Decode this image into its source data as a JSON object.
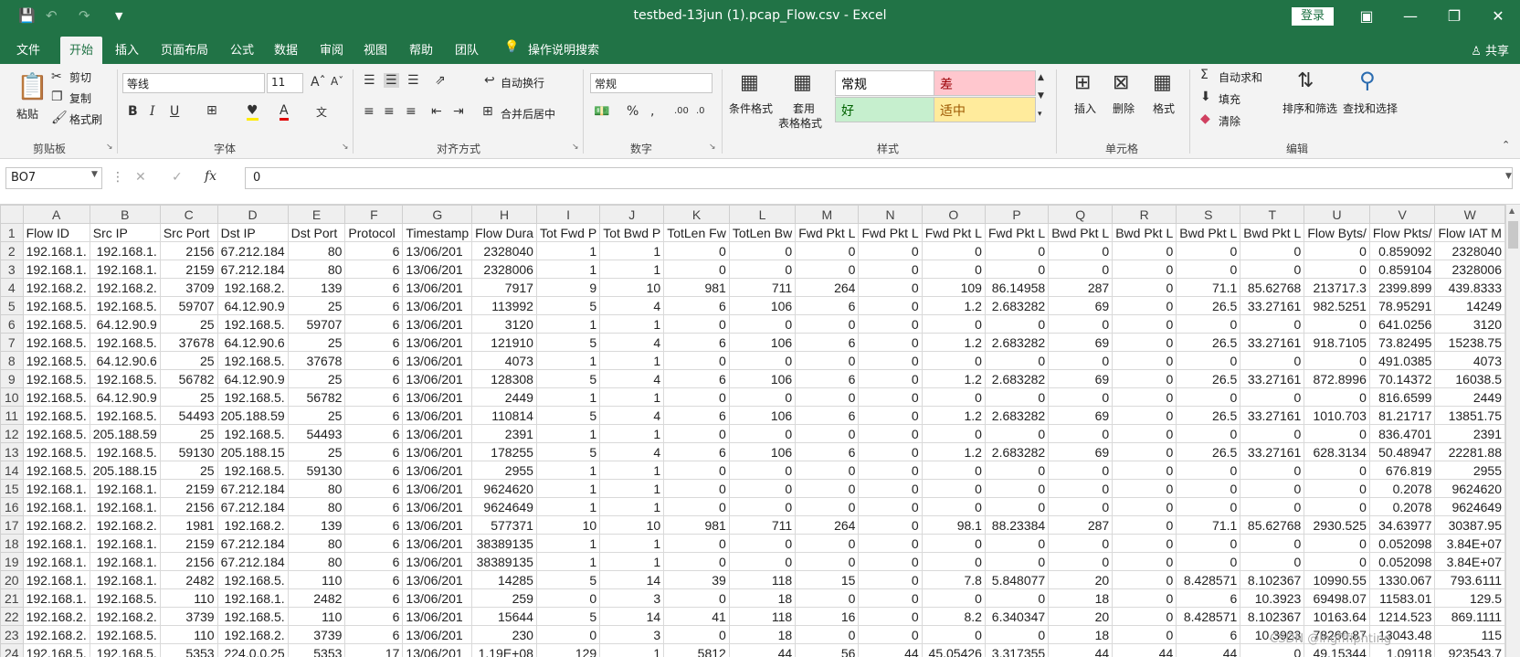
{
  "window": {
    "title": "testbed-13jun (1).pcap_Flow.csv  -  Excel",
    "login_label": "登录"
  },
  "tabs": [
    "文件",
    "开始",
    "插入",
    "页面布局",
    "公式",
    "数据",
    "审阅",
    "视图",
    "帮助",
    "团队"
  ],
  "search_label": "操作说明搜索",
  "share_label": "共享",
  "ribbon": {
    "clipboard": {
      "paste": "粘贴",
      "cut": "剪切",
      "copy": "复制",
      "painter": "格式刷",
      "group": "剪贴板"
    },
    "font": {
      "name": "等线",
      "size": "11",
      "group": "字体"
    },
    "align": {
      "wrap": "自动换行",
      "merge": "合并后居中",
      "group": "对齐方式"
    },
    "number": {
      "format": "常规",
      "group": "数字"
    },
    "styles": {
      "cond": "条件格式",
      "table1": "套用",
      "table2": "表格格式",
      "normal": "常规",
      "bad": "差",
      "good": "好",
      "neutral": "适中",
      "group": "样式"
    },
    "cells": {
      "insert": "插入",
      "delete": "删除",
      "format": "格式",
      "group": "单元格"
    },
    "editing": {
      "autosum": "自动求和",
      "fill": "填充",
      "clear": "清除",
      "sort": "排序和筛选",
      "find": "查找和选择",
      "group": "编辑"
    }
  },
  "formula_bar": {
    "name_box": "BO7",
    "value": "0"
  },
  "columns": [
    "A",
    "B",
    "C",
    "D",
    "E",
    "F",
    "G",
    "H",
    "I",
    "J",
    "K",
    "L",
    "M",
    "N",
    "O",
    "P",
    "Q",
    "R",
    "S",
    "T",
    "U",
    "V",
    "W"
  ],
  "rows": [
    [
      "Flow ID",
      "Src IP",
      "Src Port",
      "Dst IP",
      "Dst Port",
      "Protocol",
      "Timestamp",
      "Flow Dura",
      "Tot Fwd P",
      "Tot Bwd P",
      "TotLen Fw",
      "TotLen Bw",
      "Fwd Pkt L",
      "Fwd Pkt L",
      "Fwd Pkt L",
      "Fwd Pkt L",
      "Bwd Pkt L",
      "Bwd Pkt L",
      "Bwd Pkt L",
      "Bwd Pkt L",
      "Flow Byts/",
      "Flow Pkts/",
      "Flow IAT M"
    ],
    [
      "192.168.1.",
      "192.168.1.",
      "2156",
      "67.212.184",
      "80",
      "6",
      "13/06/201",
      "2328040",
      "1",
      "1",
      "0",
      "0",
      "0",
      "0",
      "0",
      "0",
      "0",
      "0",
      "0",
      "0",
      "0",
      "0.859092",
      "2328040"
    ],
    [
      "192.168.1.",
      "192.168.1.",
      "2159",
      "67.212.184",
      "80",
      "6",
      "13/06/201",
      "2328006",
      "1",
      "1",
      "0",
      "0",
      "0",
      "0",
      "0",
      "0",
      "0",
      "0",
      "0",
      "0",
      "0",
      "0.859104",
      "2328006"
    ],
    [
      "192.168.2.",
      "192.168.2.",
      "3709",
      "192.168.2.",
      "139",
      "6",
      "13/06/201",
      "7917",
      "9",
      "10",
      "981",
      "711",
      "264",
      "0",
      "109",
      "86.14958",
      "287",
      "0",
      "71.1",
      "85.62768",
      "213717.3",
      "2399.899",
      "439.8333"
    ],
    [
      "192.168.5.",
      "192.168.5.",
      "59707",
      "64.12.90.9",
      "25",
      "6",
      "13/06/201",
      "113992",
      "5",
      "4",
      "6",
      "106",
      "6",
      "0",
      "1.2",
      "2.683282",
      "69",
      "0",
      "26.5",
      "33.27161",
      "982.5251",
      "78.95291",
      "14249"
    ],
    [
      "192.168.5.",
      "64.12.90.9",
      "25",
      "192.168.5.",
      "59707",
      "6",
      "13/06/201",
      "3120",
      "1",
      "1",
      "0",
      "0",
      "0",
      "0",
      "0",
      "0",
      "0",
      "0",
      "0",
      "0",
      "0",
      "641.0256",
      "3120"
    ],
    [
      "192.168.5.",
      "192.168.5.",
      "37678",
      "64.12.90.6",
      "25",
      "6",
      "13/06/201",
      "121910",
      "5",
      "4",
      "6",
      "106",
      "6",
      "0",
      "1.2",
      "2.683282",
      "69",
      "0",
      "26.5",
      "33.27161",
      "918.7105",
      "73.82495",
      "15238.75"
    ],
    [
      "192.168.5.",
      "64.12.90.6",
      "25",
      "192.168.5.",
      "37678",
      "6",
      "13/06/201",
      "4073",
      "1",
      "1",
      "0",
      "0",
      "0",
      "0",
      "0",
      "0",
      "0",
      "0",
      "0",
      "0",
      "0",
      "491.0385",
      "4073"
    ],
    [
      "192.168.5.",
      "192.168.5.",
      "56782",
      "64.12.90.9",
      "25",
      "6",
      "13/06/201",
      "128308",
      "5",
      "4",
      "6",
      "106",
      "6",
      "0",
      "1.2",
      "2.683282",
      "69",
      "0",
      "26.5",
      "33.27161",
      "872.8996",
      "70.14372",
      "16038.5"
    ],
    [
      "192.168.5.",
      "64.12.90.9",
      "25",
      "192.168.5.",
      "56782",
      "6",
      "13/06/201",
      "2449",
      "1",
      "1",
      "0",
      "0",
      "0",
      "0",
      "0",
      "0",
      "0",
      "0",
      "0",
      "0",
      "0",
      "816.6599",
      "2449"
    ],
    [
      "192.168.5.",
      "192.168.5.",
      "54493",
      "205.188.59",
      "25",
      "6",
      "13/06/201",
      "110814",
      "5",
      "4",
      "6",
      "106",
      "6",
      "0",
      "1.2",
      "2.683282",
      "69",
      "0",
      "26.5",
      "33.27161",
      "1010.703",
      "81.21717",
      "13851.75"
    ],
    [
      "192.168.5.",
      "205.188.59",
      "25",
      "192.168.5.",
      "54493",
      "6",
      "13/06/201",
      "2391",
      "1",
      "1",
      "0",
      "0",
      "0",
      "0",
      "0",
      "0",
      "0",
      "0",
      "0",
      "0",
      "0",
      "836.4701",
      "2391"
    ],
    [
      "192.168.5.",
      "192.168.5.",
      "59130",
      "205.188.15",
      "25",
      "6",
      "13/06/201",
      "178255",
      "5",
      "4",
      "6",
      "106",
      "6",
      "0",
      "1.2",
      "2.683282",
      "69",
      "0",
      "26.5",
      "33.27161",
      "628.3134",
      "50.48947",
      "22281.88"
    ],
    [
      "192.168.5.",
      "205.188.15",
      "25",
      "192.168.5.",
      "59130",
      "6",
      "13/06/201",
      "2955",
      "1",
      "1",
      "0",
      "0",
      "0",
      "0",
      "0",
      "0",
      "0",
      "0",
      "0",
      "0",
      "0",
      "676.819",
      "2955"
    ],
    [
      "192.168.1.",
      "192.168.1.",
      "2159",
      "67.212.184",
      "80",
      "6",
      "13/06/201",
      "9624620",
      "1",
      "1",
      "0",
      "0",
      "0",
      "0",
      "0",
      "0",
      "0",
      "0",
      "0",
      "0",
      "0",
      "0.2078",
      "9624620"
    ],
    [
      "192.168.1.",
      "192.168.1.",
      "2156",
      "67.212.184",
      "80",
      "6",
      "13/06/201",
      "9624649",
      "1",
      "1",
      "0",
      "0",
      "0",
      "0",
      "0",
      "0",
      "0",
      "0",
      "0",
      "0",
      "0",
      "0.2078",
      "9624649"
    ],
    [
      "192.168.2.",
      "192.168.2.",
      "1981",
      "192.168.2.",
      "139",
      "6",
      "13/06/201",
      "577371",
      "10",
      "10",
      "981",
      "711",
      "264",
      "0",
      "98.1",
      "88.23384",
      "287",
      "0",
      "71.1",
      "85.62768",
      "2930.525",
      "34.63977",
      "30387.95"
    ],
    [
      "192.168.1.",
      "192.168.1.",
      "2159",
      "67.212.184",
      "80",
      "6",
      "13/06/201",
      "38389135",
      "1",
      "1",
      "0",
      "0",
      "0",
      "0",
      "0",
      "0",
      "0",
      "0",
      "0",
      "0",
      "0",
      "0.052098",
      "3.84E+07"
    ],
    [
      "192.168.1.",
      "192.168.1.",
      "2156",
      "67.212.184",
      "80",
      "6",
      "13/06/201",
      "38389135",
      "1",
      "1",
      "0",
      "0",
      "0",
      "0",
      "0",
      "0",
      "0",
      "0",
      "0",
      "0",
      "0",
      "0.052098",
      "3.84E+07"
    ],
    [
      "192.168.1.",
      "192.168.1.",
      "2482",
      "192.168.5.",
      "110",
      "6",
      "13/06/201",
      "14285",
      "5",
      "14",
      "39",
      "118",
      "15",
      "0",
      "7.8",
      "5.848077",
      "20",
      "0",
      "8.428571",
      "8.102367",
      "10990.55",
      "1330.067",
      "793.6111"
    ],
    [
      "192.168.1.",
      "192.168.5.",
      "110",
      "192.168.1.",
      "2482",
      "6",
      "13/06/201",
      "259",
      "0",
      "3",
      "0",
      "18",
      "0",
      "0",
      "0",
      "0",
      "18",
      "0",
      "6",
      "10.3923",
      "69498.07",
      "11583.01",
      "129.5"
    ],
    [
      "192.168.2.",
      "192.168.2.",
      "3739",
      "192.168.5.",
      "110",
      "6",
      "13/06/201",
      "15644",
      "5",
      "14",
      "41",
      "118",
      "16",
      "0",
      "8.2",
      "6.340347",
      "20",
      "0",
      "8.428571",
      "8.102367",
      "10163.64",
      "1214.523",
      "869.1111"
    ],
    [
      "192.168.2.",
      "192.168.5.",
      "110",
      "192.168.2.",
      "3739",
      "6",
      "13/06/201",
      "230",
      "0",
      "3",
      "0",
      "18",
      "0",
      "0",
      "0",
      "0",
      "18",
      "0",
      "6",
      "10.3923",
      "78260.87",
      "13043.48",
      "115"
    ],
    [
      "192.168.5.",
      "192.168.5.",
      "5353",
      "224.0.0.25",
      "5353",
      "17",
      "13/06/201",
      "1.19E+08",
      "129",
      "1",
      "5812",
      "44",
      "56",
      "44",
      "45.05426",
      "3.317355",
      "44",
      "44",
      "44",
      "0",
      "49.15344",
      "1.09118",
      "923543.7"
    ]
  ],
  "watermark": "CSDN @lngfffiphting"
}
